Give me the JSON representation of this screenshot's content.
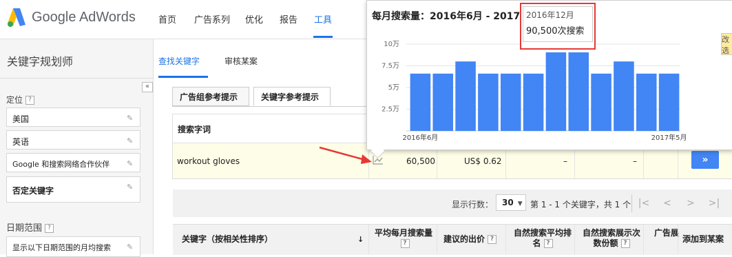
{
  "brand": {
    "name": "Google AdWords"
  },
  "nav": {
    "items": [
      "首页",
      "广告系列",
      "优化",
      "报告",
      "工具"
    ],
    "active": "工具"
  },
  "tool_title": "关键字规划师",
  "subnav": {
    "items": [
      "查找关键字",
      "审核某案"
    ],
    "active": "查找关键字"
  },
  "sidebar": {
    "targeting_label": "定位",
    "fields": [
      "美国",
      "英语",
      "Google 和搜索网络合作伙伴",
      "否定关键字"
    ],
    "date_label": "日期范围",
    "date_value": "显示以下日期范围的月均搜索"
  },
  "tabs": [
    "广告组参考提示",
    "关键字参考提示"
  ],
  "table": {
    "header_keyword": "搜索字词",
    "header_add": "案",
    "row": {
      "keyword": "workout gloves",
      "avg_searches": "60,500",
      "bid": "US$ 0.62",
      "c1": "–",
      "c2": "–",
      "add_label": "»"
    }
  },
  "pager": {
    "label": "显示行数：",
    "rows": "30",
    "info": "第 1 - 1 个关键字，共 1 个",
    "buttons": [
      "|<",
      "<",
      ">",
      ">|"
    ]
  },
  "bottom_header": {
    "keyword": "关键字（按相关性排序）",
    "avg": "平均每月搜索量",
    "bid": "建议的出价",
    "organic_rank": "自然搜索平均排名",
    "organic_share": "自然搜索展示次数份额",
    "ad": "广告展",
    "add": "添加到某案"
  },
  "popup": {
    "title": "每月搜索量：2016年6月 - 2017",
    "tooltip": {
      "date": "2016年12月",
      "value": "90,500次搜索"
    },
    "right_edge_text": "改选"
  },
  "chart_data": {
    "type": "bar",
    "categories": [
      "2016年6月",
      "2016年7月",
      "2016年8月",
      "2016年9月",
      "2016年10月",
      "2016年11月",
      "2016年12月",
      "2017年1月",
      "2017年2月",
      "2017年3月",
      "2017年4月",
      "2017年5月"
    ],
    "values": [
      66000,
      66000,
      80000,
      66000,
      66000,
      66000,
      90500,
      90500,
      66000,
      80000,
      66000,
      66000
    ],
    "x_tick_labels": [
      "2016年6月",
      "2017年5月"
    ],
    "y_tick_labels": [
      "2.5万",
      "5万",
      "7.5万",
      "10万"
    ],
    "y_ticks": [
      25000,
      50000,
      75000,
      100000
    ],
    "ylim": [
      0,
      100000
    ],
    "bar_color": "#4285f4",
    "highlighted": "2016年12月"
  },
  "colors": {
    "accent": "#1a73e8",
    "bar": "#4285f4",
    "highlight_border": "#e53935",
    "row_highlight": "#fefde7"
  }
}
